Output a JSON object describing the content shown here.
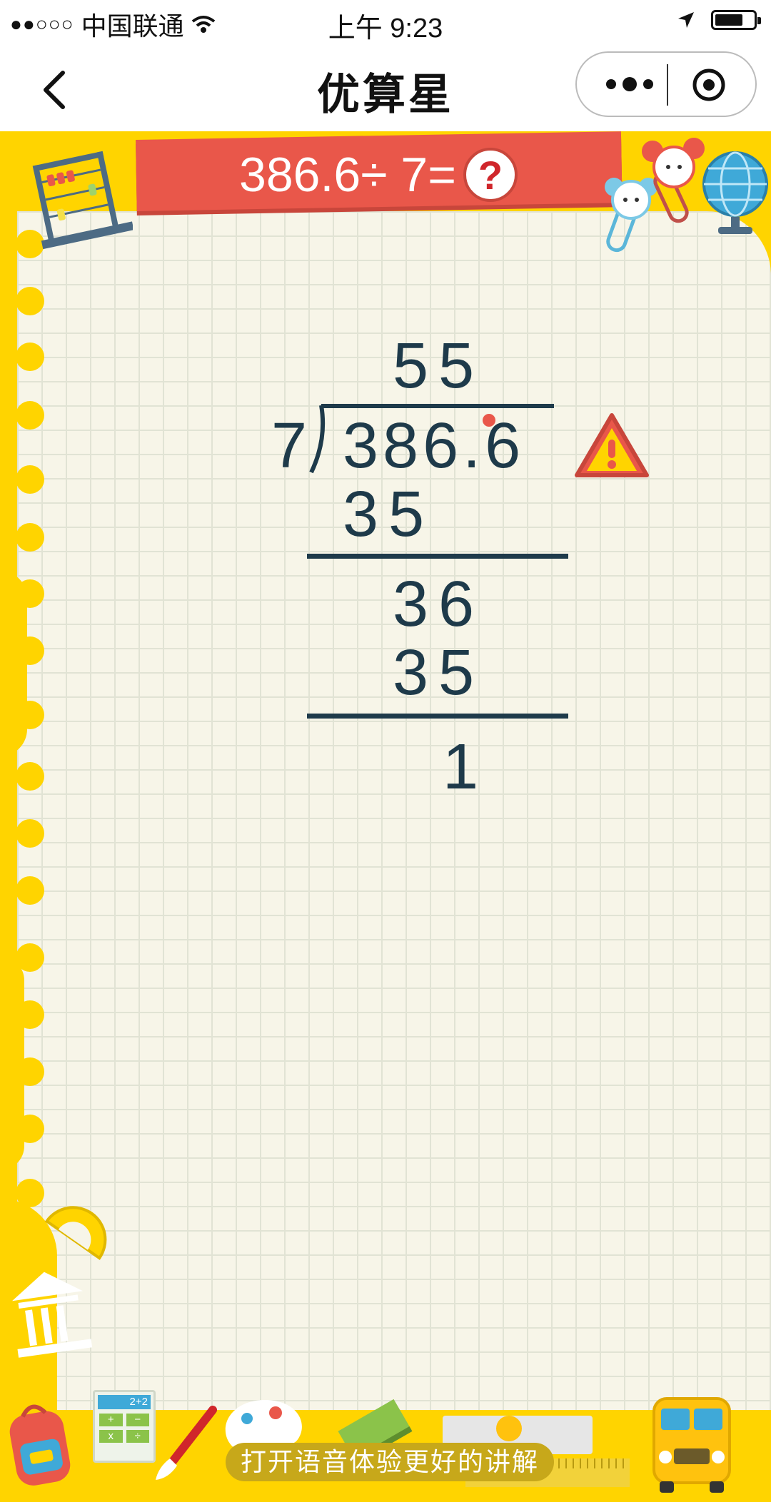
{
  "status_bar": {
    "signal": "●●○○○",
    "carrier": "中国联通",
    "time": "上午 9:23"
  },
  "nav": {
    "title": "优算星"
  },
  "problem": {
    "expression": "386.6÷ 7=",
    "help_symbol": "?"
  },
  "division": {
    "quotient": "55",
    "divisor": "7",
    "dividend": "386.6",
    "step1_product": "35",
    "step2_remainder": "36",
    "step2_product": "35",
    "remainder": "1"
  },
  "calculator": {
    "display": "2+2",
    "keys": [
      "+",
      "−",
      "x",
      "÷"
    ]
  },
  "voice_prompt": "打开语音体验更好的讲解",
  "colors": {
    "background": "#FFD400",
    "paper": "#F7F5E8",
    "banner": "#E9574A",
    "ink": "#1e3a4a",
    "warning": "#E9574A"
  }
}
